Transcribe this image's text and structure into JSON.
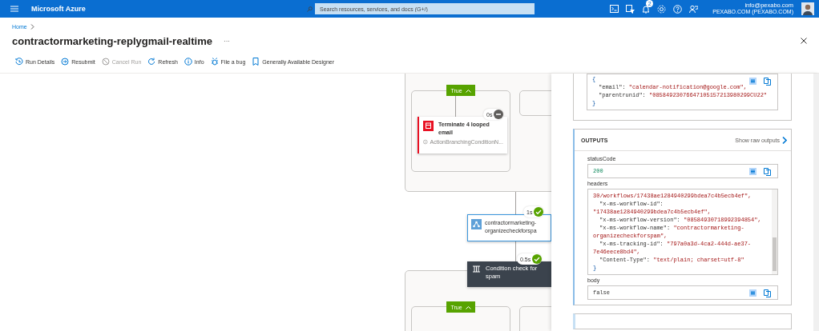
{
  "topbar": {
    "brand": "Microsoft Azure",
    "search": {
      "placeholder": "Search resources, services, and docs (G+/)"
    },
    "notification_count": "2",
    "account": {
      "email": "info@pexabo.com",
      "directory": "PEXABO.COM (PEXABO.COM)"
    }
  },
  "breadcrumb": [
    "Home"
  ],
  "title": "contractormarketing-replygmail-realtime",
  "more": "···",
  "toolbar": [
    {
      "label": "Run Details",
      "kind": "details",
      "disabled": false
    },
    {
      "label": "Resubmit",
      "kind": "resubmit",
      "disabled": false
    },
    {
      "label": "Cancel Run",
      "kind": "cancel",
      "disabled": true
    },
    {
      "label": "Refresh",
      "kind": "refresh",
      "disabled": false
    },
    {
      "label": "Info",
      "kind": "info",
      "disabled": false
    },
    {
      "label": "File a bug",
      "kind": "bug",
      "disabled": false
    },
    {
      "label": "Generally Available Designer",
      "kind": "designer",
      "disabled": false
    }
  ],
  "canvas": {
    "nodes": [
      {
        "kind": "branch",
        "label": "True"
      },
      {
        "kind": "terminate",
        "title": "Terminate 4 looped email",
        "subtitle": "ActionBranchingConditionN...",
        "duration": "0s",
        "skipped": true
      },
      {
        "kind": "scope",
        "title": "contractormarketing-organizecheckforspa",
        "duration": "1s",
        "skipped": false
      },
      {
        "kind": "condition",
        "title": "Condition check for spam",
        "duration": "0.5s",
        "skipped": false
      },
      {
        "kind": "branch",
        "label": "True"
      }
    ]
  },
  "panel": {
    "inputs_code": [
      {
        "kind": "brace",
        "text": "{"
      },
      {
        "kind": "pair",
        "key": "\"email\":",
        "value": "\"calendar-notification@google.com\","
      },
      {
        "kind": "pair",
        "key": "\"parentrunid\":",
        "value": "\"08584923076647105157213980299CU22\""
      },
      {
        "kind": "brace",
        "text": "}"
      }
    ],
    "outputs": {
      "title": "OUTPUTS",
      "raw_link": "Show raw outputs",
      "fields": [
        {
          "label": "statusCode",
          "kind": "number",
          "lines": [
            {
              "kind": "plain",
              "text": "200"
            }
          ]
        },
        {
          "label": "headers",
          "kind": "scroll",
          "lines": [
            {
              "kind": "value",
              "text": "30/workflows/17438ae1284940299bdea7c4b5ecb4ef\","
            },
            {
              "kind": "pair",
              "key": "\"x-ms-workflow-id\":"
            },
            {
              "kind": "value",
              "text": "\"17438ae1284940299bdea7c4b5ecb4ef\","
            },
            {
              "kind": "pair",
              "key": "\"x-ms-workflow-version\":",
              "value": "\"08584930718992394854\","
            },
            {
              "kind": "pair",
              "key": "\"x-ms-workflow-name\":",
              "value": "\"contractormarketing-"
            },
            {
              "kind": "value",
              "text": "organizecheckforspam\","
            },
            {
              "kind": "pair",
              "key": "\"x-ms-tracking-id\":",
              "value": "\"797a0a3d-4ca2-444d-ae37-"
            },
            {
              "kind": "value",
              "text": "7e46eece8bd4\","
            },
            {
              "kind": "pair",
              "key": "\"Content-Type\":",
              "value": "\"text/plain; charset=utf-8\""
            },
            {
              "kind": "brace",
              "text": "}"
            }
          ]
        },
        {
          "label": "body",
          "kind": "text",
          "lines": [
            {
              "kind": "plain",
              "text": "false"
            }
          ]
        }
      ]
    }
  }
}
